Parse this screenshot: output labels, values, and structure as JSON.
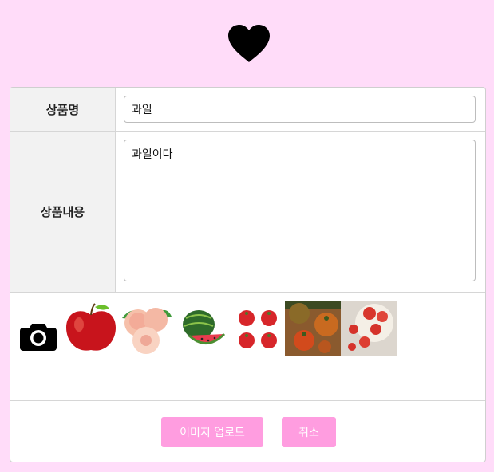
{
  "form": {
    "name_label": "상품명",
    "name_value": "과일",
    "desc_label": "상품내용",
    "desc_value": "과일이다"
  },
  "images": {
    "camera_icon": "camera-icon",
    "thumbnails": [
      "apple",
      "peach",
      "watermelon",
      "cherry-tomatoes",
      "heirloom-tomatoes",
      "tomatoes-on-plate"
    ]
  },
  "buttons": {
    "upload_label": "이미지 업로드",
    "cancel_label": "취소"
  },
  "colors": {
    "background": "#ffdcf9",
    "button": "#ff9de0"
  }
}
